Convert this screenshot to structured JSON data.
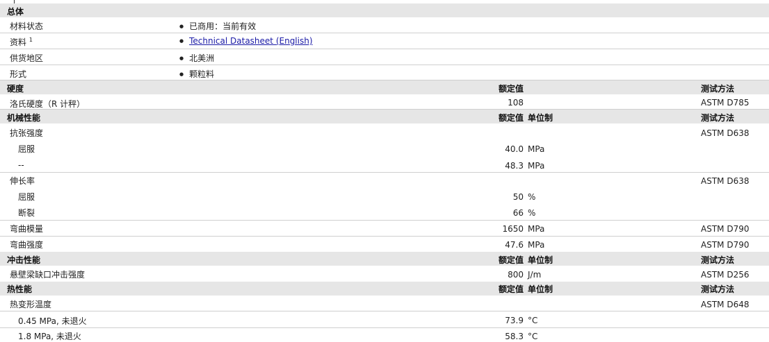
{
  "general": {
    "title": "总体",
    "rows": [
      {
        "label": "材料状态",
        "value": "已商用：当前有效"
      },
      {
        "label": "资料",
        "sup": "1",
        "value": "Technical Datasheet (English)",
        "link": true
      },
      {
        "label": "供货地区",
        "value": "北美洲"
      },
      {
        "label": "形式",
        "value": "颗粒料"
      }
    ]
  },
  "hardness": {
    "title": "硬度",
    "h_value": "额定值",
    "h_test": "测试方法",
    "rows": [
      {
        "label": "洛氏硬度（R 计秤）",
        "value": "108",
        "unit": "",
        "test": "ASTM D785"
      }
    ]
  },
  "mechanical": {
    "title": "机械性能",
    "h_value": "额定值",
    "h_unit": "单位制",
    "h_test": "测试方法",
    "rows": [
      {
        "label": "抗张强度",
        "test": "ASTM D638"
      },
      {
        "sub": "屈服",
        "value": "40.0",
        "unit": "MPa"
      },
      {
        "sub": "--",
        "value": "48.3",
        "unit": "MPa"
      },
      {
        "label": "伸长率",
        "test": "ASTM D638"
      },
      {
        "sub": "屈服",
        "value": "50",
        "unit": "%"
      },
      {
        "sub": "断裂",
        "value": "66",
        "unit": "%"
      },
      {
        "label": "弯曲模量",
        "value": "1650",
        "unit": "MPa",
        "test": "ASTM D790"
      },
      {
        "label": "弯曲强度",
        "value": "47.6",
        "unit": "MPa",
        "test": "ASTM D790"
      }
    ]
  },
  "impact": {
    "title": "冲击性能",
    "h_value": "额定值",
    "h_unit": "单位制",
    "h_test": "测试方法",
    "rows": [
      {
        "label": "悬壁梁缺口冲击强度",
        "value": "800",
        "unit": "J/m",
        "test": "ASTM D256"
      }
    ]
  },
  "thermal": {
    "title": "热性能",
    "h_value": "额定值",
    "h_unit": "单位制",
    "h_test": "测试方法",
    "rows": [
      {
        "label": "热变形温度",
        "test": "ASTM D648"
      },
      {
        "sub": "0.45 MPa, 未退火",
        "value": "73.9",
        "unit": "°C"
      },
      {
        "sub": "1.8 MPa, 未退火",
        "value": "58.3",
        "unit": "°C"
      }
    ]
  }
}
